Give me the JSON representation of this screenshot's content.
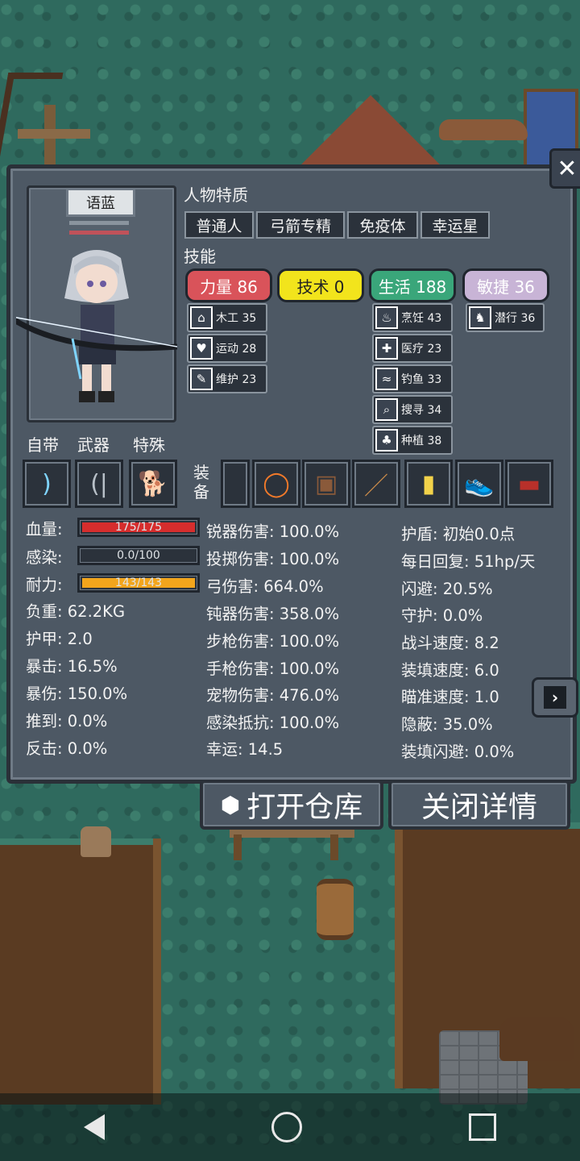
{
  "character": {
    "name": "语蓝"
  },
  "traits": {
    "title": "人物特质",
    "items": [
      "普通人",
      "弓箭专精",
      "免疫体",
      "幸运星"
    ]
  },
  "skills": {
    "title": "技能",
    "attributes": [
      {
        "label": "力量 86",
        "bg": "#d9535a",
        "fg": "#ffffff"
      },
      {
        "label": "技术 0",
        "bg": "#f2e41c",
        "fg": "#222222"
      },
      {
        "label": "生活 188",
        "bg": "#3aa67a",
        "fg": "#ffffff"
      },
      {
        "label": "敏捷 36",
        "bg": "#c8b4d6",
        "fg": "#ffffff"
      }
    ],
    "strength": [
      {
        "label": "木工 35",
        "icon": "house-icon"
      },
      {
        "label": "运动 28",
        "icon": "heart-icon"
      },
      {
        "label": "维护 23",
        "icon": "wrench-icon"
      }
    ],
    "life": [
      {
        "label": "烹饪 43",
        "icon": "pot-icon"
      },
      {
        "label": "医疗 23",
        "icon": "medkit-icon"
      },
      {
        "label": "钓鱼 33",
        "icon": "fish-icon"
      },
      {
        "label": "搜寻 34",
        "icon": "magnifier-icon"
      },
      {
        "label": "种植 38",
        "icon": "plant-icon"
      }
    ],
    "agility": [
      {
        "label": "潜行 36",
        "icon": "sneak-icon"
      }
    ]
  },
  "slots": {
    "tabs": [
      "自带",
      "武器",
      "特殊"
    ],
    "equipment_label": "装\n备",
    "innate": "bow-icon",
    "weapon": "recurve-bow-icon",
    "special": "corgi-icon",
    "equipment": [
      "empty",
      "ring-icon",
      "backpack-icon",
      "longbow-icon",
      "manual-icon",
      "sneaker-icon",
      "book-icon"
    ]
  },
  "bars": {
    "hp": {
      "label": "血量:",
      "text": "175/175",
      "fill": 1.0,
      "color": "#d62d2d"
    },
    "infection": {
      "label": "感染:",
      "text": "0.0/100",
      "fill": 0.0,
      "color": "#2d6ad6"
    },
    "stamina": {
      "label": "耐力:",
      "text": "143/143",
      "fill": 1.0,
      "color": "#f2a51c"
    }
  },
  "stats_left": [
    "负重: 62.2KG",
    "护甲: 2.0",
    "暴击: 16.5%",
    "暴伤: 150.0%",
    "推到: 0.0%",
    "反击: 0.0%"
  ],
  "stats_mid": [
    "锐器伤害: 100.0%",
    "投掷伤害: 100.0%",
    "弓伤害: 664.0%",
    "钝器伤害: 358.0%",
    "步枪伤害: 100.0%",
    "手枪伤害: 100.0%",
    "宠物伤害: 476.0%",
    "感染抵抗: 100.0%",
    "幸运: 14.5"
  ],
  "stats_right": [
    "护盾: 初始0.0点",
    "每日回复: 51hp/天",
    "闪避: 20.5%",
    "守护: 0.0%",
    "战斗速度: 8.2",
    "装填速度: 6.0",
    "瞄准速度: 1.0",
    "隐蔽: 35.0%",
    "装填闪避: 0.0%"
  ],
  "actions": {
    "open_storage": "打开仓库",
    "close_details": "关闭详情"
  }
}
